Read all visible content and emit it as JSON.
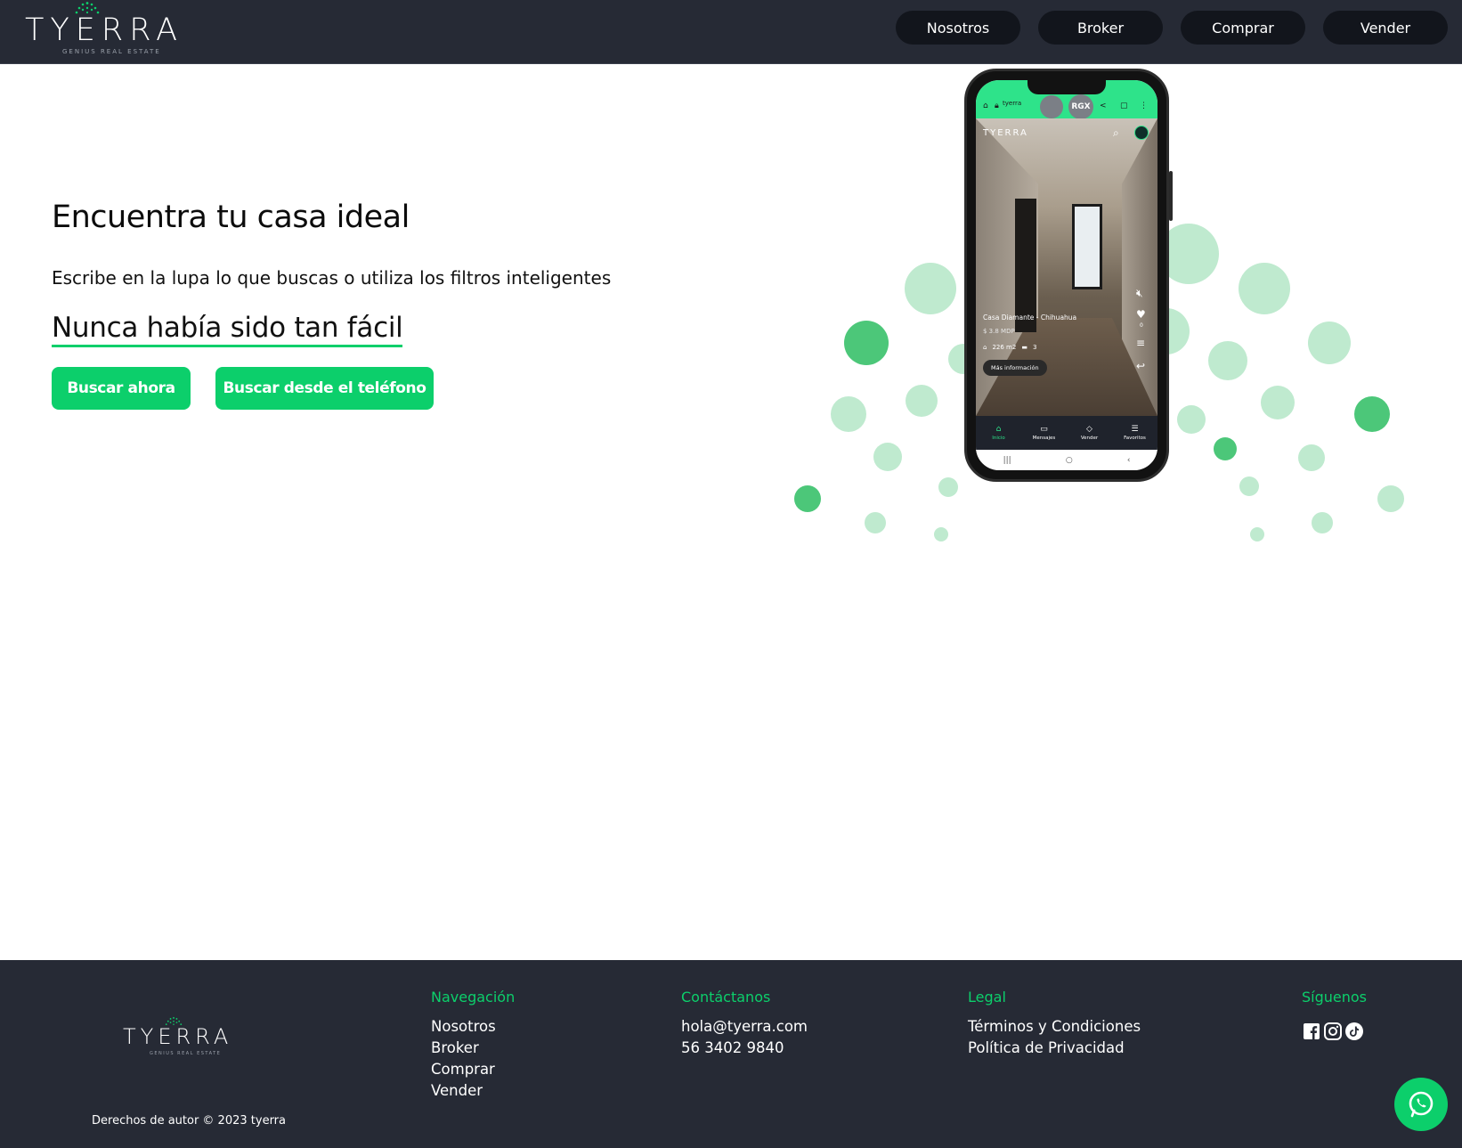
{
  "header": {
    "logo": {
      "word": "TYERRA",
      "tagline": "GENIUS REAL ESTATE"
    },
    "nav": [
      "Nosotros",
      "Broker",
      "Comprar",
      "Vender"
    ]
  },
  "hero": {
    "title": "Encuentra tu casa ideal",
    "subtitle": "Escribe en la lupa lo que buscas o utiliza los filtros inteligentes",
    "tagline": "Nunca había sido tan fácil",
    "cta_primary": "Buscar ahora",
    "cta_secondary": "Buscar desde el teléfono"
  },
  "phone": {
    "browser_url": "tyerra",
    "browser_badge": "RGX",
    "app_logo": "TYERRA",
    "listing_title": "Casa Diamante - Chihuahua",
    "listing_price": "$ 3.8 MDP",
    "listing_area": "226 m2",
    "listing_rooms": "3",
    "listing_more": "Más información",
    "like_count": "0",
    "tabs": [
      "Inicio",
      "Mensajes",
      "Vender",
      "Favoritos"
    ]
  },
  "footer": {
    "logo": {
      "word": "TYERRA",
      "tagline": "GENIUS REAL ESTATE"
    },
    "copyright": "Derechos de autor © 2023 tyerra",
    "nav_heading": "Navegación",
    "nav_links": [
      "Nosotros",
      "Broker",
      "Comprar",
      "Vender"
    ],
    "contact_heading": "Contáctanos",
    "contact_email": "hola@tyerra.com",
    "contact_phone": "56 3402 9840",
    "legal_heading": "Legal",
    "legal_links": [
      "Términos y Condiciones",
      "Política de Privacidad"
    ],
    "social_heading": "Síguenos",
    "social_icons": [
      "facebook-icon",
      "instagram-icon",
      "tiktok-icon"
    ]
  },
  "colors": {
    "brand_green": "#0ccf6b",
    "dark_bg": "#262a35",
    "nav_button": "#12151c",
    "dot_light": "#bfeacf",
    "dot_dark": "#4cc779"
  }
}
